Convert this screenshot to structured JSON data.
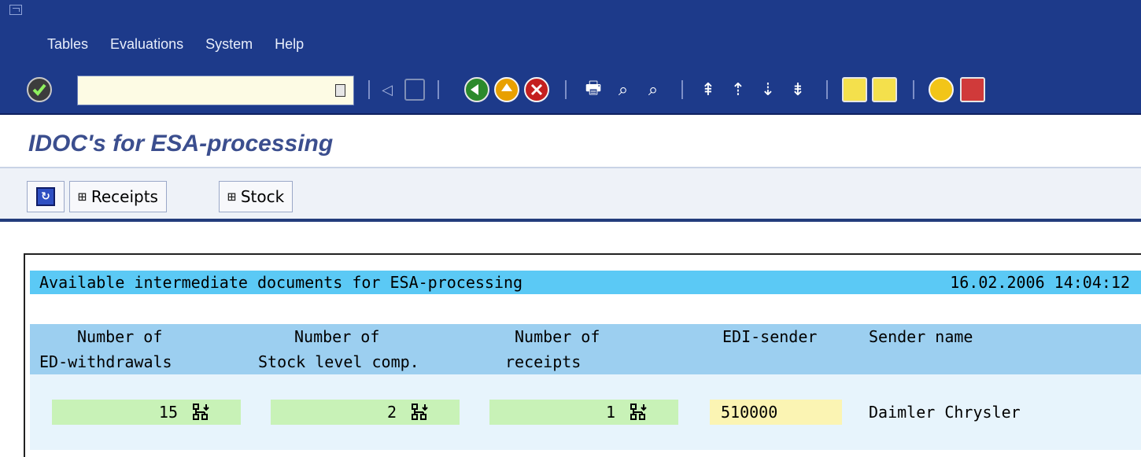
{
  "menubar": {
    "items": [
      {
        "label": "Tables"
      },
      {
        "label": "Evaluations"
      },
      {
        "label": "System"
      },
      {
        "label": "Help"
      }
    ]
  },
  "toolbar": {
    "command_value": "",
    "icons": [
      "enter-icon",
      "command-dropdown-icon",
      "back-arrow-icon",
      "save-icon",
      "back-icon",
      "exit-icon",
      "cancel-icon",
      "print-icon",
      "find-icon",
      "find-next-icon",
      "first-page-icon",
      "previous-page-icon",
      "next-page-icon",
      "last-page-icon",
      "create-session-icon",
      "create-shortcut-icon",
      "help-icon",
      "layout-menu-icon"
    ]
  },
  "title": {
    "text": "IDOC's for ESA-processing"
  },
  "app_toolbar": {
    "refresh_icon": "refresh-icon",
    "receipts_label": "Receipts",
    "stock_label": "Stock"
  },
  "list": {
    "header_text": "Available intermediate documents for ESA-processing",
    "header_datetime": "16.02.2006 14:04:12",
    "columns_row1": [
      "Number of",
      "Number of",
      "Number of",
      "EDI-sender",
      "Sender name"
    ],
    "columns_row2": [
      "ED-withdrawals",
      "Stock level comp.",
      "receipts",
      "",
      ""
    ],
    "rows": [
      {
        "withdrawals": "15",
        "stock_level": "2",
        "receipts": "1",
        "edi_sender": "510000",
        "sender_name": "Daimler Chrysler"
      }
    ]
  },
  "colors": {
    "menubar_bg": "#1d3a8a",
    "title_color": "#3b4e8e",
    "list_header_bg": "#5bc9f5",
    "col_header_bg": "#9ccff0",
    "row_bg": "#e7f4fc",
    "number_cell_bg": "#c8f2b7",
    "key_cell_bg": "#fbf4b3"
  }
}
